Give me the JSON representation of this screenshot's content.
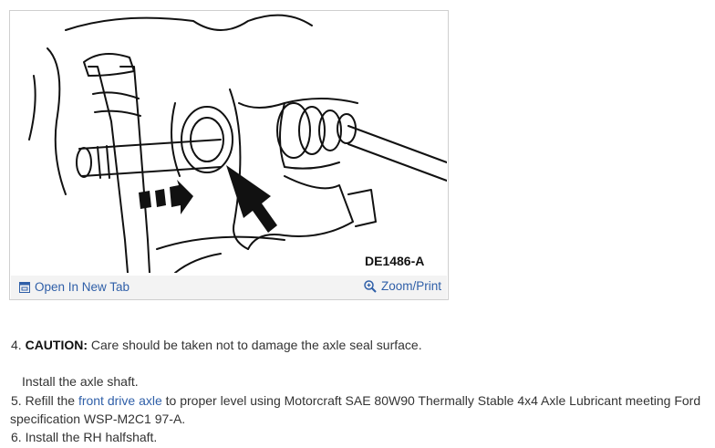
{
  "figure": {
    "label": "DE1486-A",
    "open_tab_label": "Open In New Tab",
    "zoom_label": "Zoom/Print",
    "icons": [
      "open-new-tab-icon",
      "zoom-icon"
    ],
    "link_color": "#2f5fa8"
  },
  "steps": [
    {
      "number": "4.",
      "caution_label": "CAUTION:",
      "text": "Care should be taken not to damage the axle seal surface."
    },
    {
      "subtext": "Install the axle shaft."
    },
    {
      "number": "5.",
      "text_before": "Refill the",
      "link": "front drive axle",
      "text_after": "to proper level using Motorcraft SAE 80W90 Thermally Stable 4x4 Axle Lubricant meeting Ford",
      "text_line2": "specification WSP-M2C1 97-A."
    },
    {
      "number": "6.",
      "text": "Install the RH halfshaft."
    }
  ]
}
